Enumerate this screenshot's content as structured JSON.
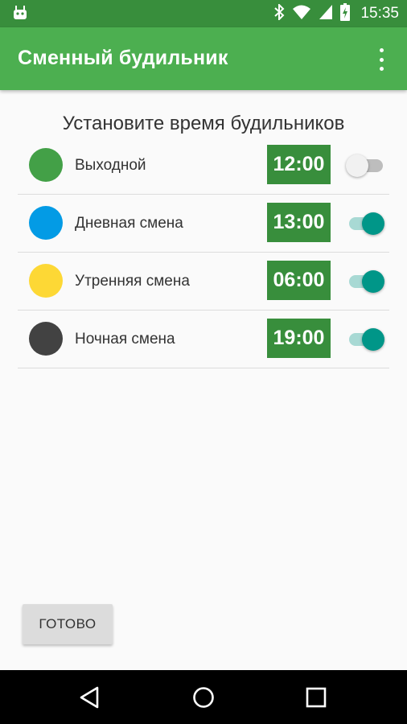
{
  "status_bar": {
    "time": "15:35",
    "icons": [
      "android-icon",
      "bluetooth-icon",
      "wifi-icon",
      "cell-signal-icon",
      "battery-charging-icon"
    ]
  },
  "app_bar": {
    "title": "Сменный будильник",
    "menu_icon": "overflow-menu-icon"
  },
  "main": {
    "heading": "Установите время будильников",
    "alarms": [
      {
        "label": "Выходной",
        "time": "12:00",
        "color": "#43a047",
        "enabled": false
      },
      {
        "label": "Дневная смена",
        "time": "13:00",
        "color": "#039be5",
        "enabled": true
      },
      {
        "label": "Утренняя смена",
        "time": "06:00",
        "color": "#fdd835",
        "enabled": true
      },
      {
        "label": "Ночная смена",
        "time": "19:00",
        "color": "#424242",
        "enabled": true
      }
    ],
    "done_label": "ГОТОВО"
  },
  "nav_bar": {
    "icons": [
      "back-icon",
      "home-icon",
      "recents-icon"
    ]
  },
  "colors": {
    "status_bar": "#388e3c",
    "app_bar": "#4caf50",
    "time_box": "#388e3c",
    "switch_on": "#009688"
  }
}
